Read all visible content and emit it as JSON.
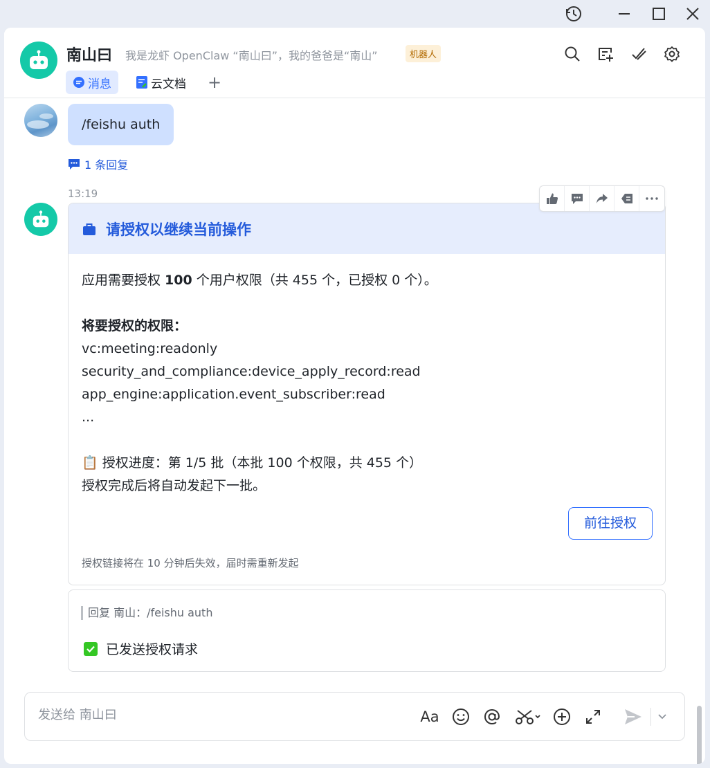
{
  "window_controls": {
    "icons": [
      "history-icon",
      "minimize-icon",
      "maximize-icon",
      "close-icon"
    ]
  },
  "header": {
    "title": "南山曰",
    "subtitle": "我是龙虾 OpenClaw “南山曰”，我的爸爸是“南山”",
    "badge": "机器人",
    "actions": [
      "search-icon",
      "add-topic-icon",
      "pin-icon",
      "settings-icon"
    ],
    "tabs": [
      {
        "label": "消息",
        "active": true
      },
      {
        "label": "云文档",
        "active": false
      }
    ],
    "add_tab": "+"
  },
  "messages": {
    "user_message": {
      "text": "/feishu auth",
      "reply_count": "1 条回复"
    },
    "timestamp": "13:19",
    "card": {
      "title": "请授权以继续当前操作",
      "intro_prefix": "应用需要授权 ",
      "intro_count": "100",
      "intro_suffix": " 个用户权限（共 455 个，已授权 0 个）。",
      "permissions_heading": "将要授权的权限：",
      "permissions": [
        "vc:meeting:readonly",
        "security_and_compliance:device_apply_record:read",
        "app_engine:application.event_subscriber:read"
      ],
      "ellipsis": "...",
      "progress_emoji": "📋",
      "progress": "授权进度：第 1/5 批（本批 100 个权限，共 455 个）",
      "auto_next": "授权完成后将自动发起下一批。",
      "button": "前往授权",
      "expire_note": "授权链接将在 10 分钟后失效，届时需重新发起"
    },
    "reply": {
      "quote": "回复 南山：/feishu auth",
      "status": "已发送授权请求"
    }
  },
  "composer": {
    "placeholder": "发送给 南山曰",
    "font_label": "Aa"
  },
  "colors": {
    "accent": "#3370ff",
    "bot_avatar": "#14c9a8",
    "card_header": "#e6edfd",
    "success": "#34c724"
  }
}
